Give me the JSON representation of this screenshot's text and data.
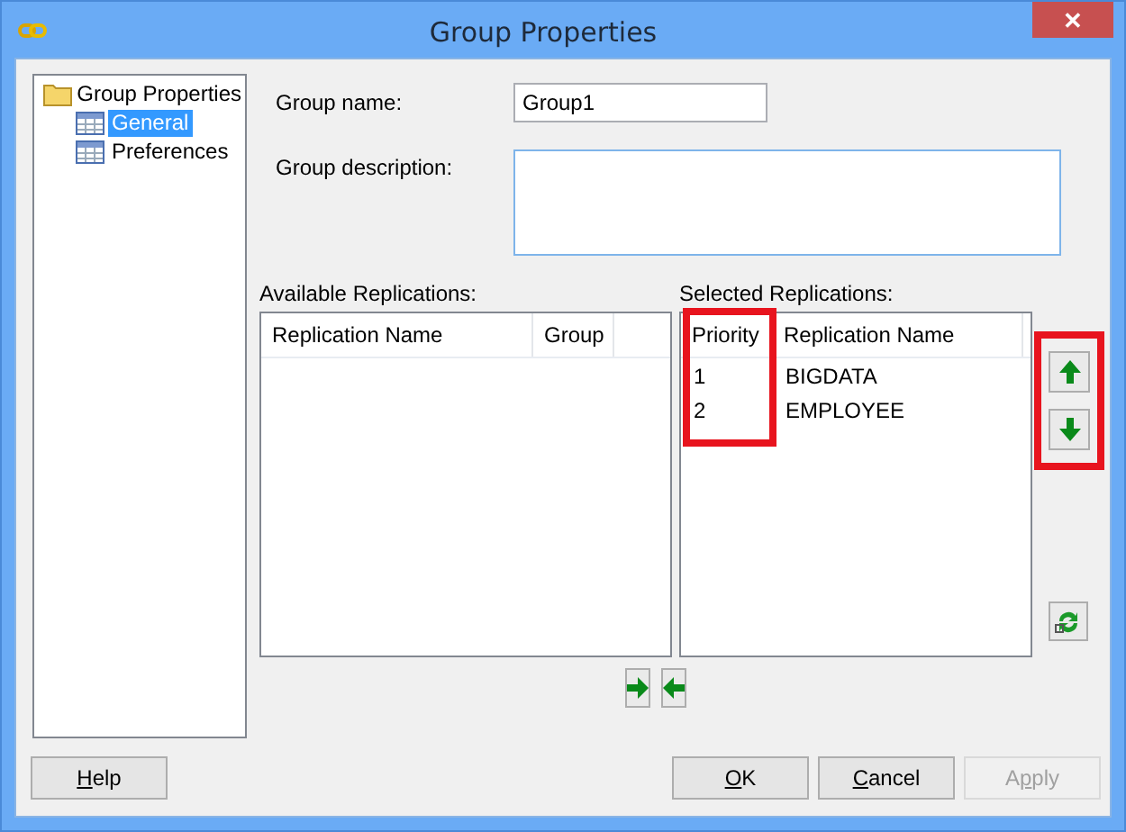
{
  "window": {
    "title": "Group Properties",
    "close": "✕"
  },
  "tree": [
    {
      "label": "Group Properties",
      "selected": false,
      "children": [
        {
          "label": "General",
          "selected": true
        },
        {
          "label": "Preferences",
          "selected": false
        }
      ]
    }
  ],
  "form": {
    "group_name_label": "Group name:",
    "group_name": "Group1",
    "description_label": "Group description:"
  },
  "available": {
    "label": "Available Replications:",
    "columns": [
      "Replication Name",
      "Group"
    ]
  },
  "selected_list": {
    "label": "Selected Replications:",
    "columns": [
      "Priority",
      "Replication Name"
    ],
    "rows": [
      [
        "1",
        "BIGDATA"
      ],
      [
        "2",
        "EMPLOYEE"
      ]
    ],
    "highlighted": true
  },
  "buttons": [
    {
      "key": "H",
      "after_key": "elp",
      "disabled": false
    },
    {
      "key": "O",
      "after_key": "K",
      "disabled": false
    },
    {
      "key": "C",
      "after_key": "ancel",
      "disabled": false
    },
    {
      "before_key": "A",
      "key": "p",
      "after_key": "ply",
      "disabled": true
    }
  ]
}
